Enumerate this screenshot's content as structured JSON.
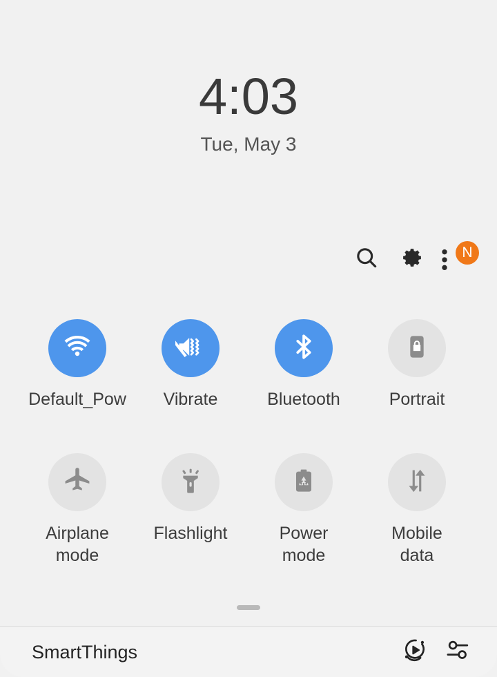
{
  "status": {
    "time": "4:03",
    "date": "Tue, May 3"
  },
  "header": {
    "actions": [
      {
        "name": "search-icon",
        "label": "Search"
      },
      {
        "name": "gear-icon",
        "label": "Settings"
      },
      {
        "name": "more-options-icon",
        "label": "More options",
        "badge": "N"
      }
    ]
  },
  "quick_settings": {
    "tiles": [
      {
        "label": "Default_Pow",
        "icon": "wifi-icon",
        "state": "on"
      },
      {
        "label": "Vibrate",
        "icon": "vibrate-icon",
        "state": "on"
      },
      {
        "label": "Bluetooth",
        "icon": "bluetooth-icon",
        "state": "on"
      },
      {
        "label": "Portrait",
        "icon": "rotation-lock-icon",
        "state": "off"
      },
      {
        "label": "Airplane\nmode",
        "icon": "airplane-icon",
        "state": "off"
      },
      {
        "label": "Flashlight",
        "icon": "flashlight-icon",
        "state": "off"
      },
      {
        "label": "Power\nmode",
        "icon": "power-mode-icon",
        "state": "off"
      },
      {
        "label": "Mobile\ndata",
        "icon": "mobile-data-icon",
        "state": "off"
      }
    ]
  },
  "bottom_bar": {
    "title": "SmartThings",
    "actions": [
      {
        "name": "media-output-icon",
        "label": "Media"
      },
      {
        "name": "device-controls-icon",
        "label": "Devices"
      }
    ]
  },
  "colors": {
    "background": "#f1f1f1",
    "tile_active": "#4e96ec",
    "tile_inactive": "#e3e3e3",
    "badge": "#f07818",
    "text_primary": "#3a3a3a"
  }
}
